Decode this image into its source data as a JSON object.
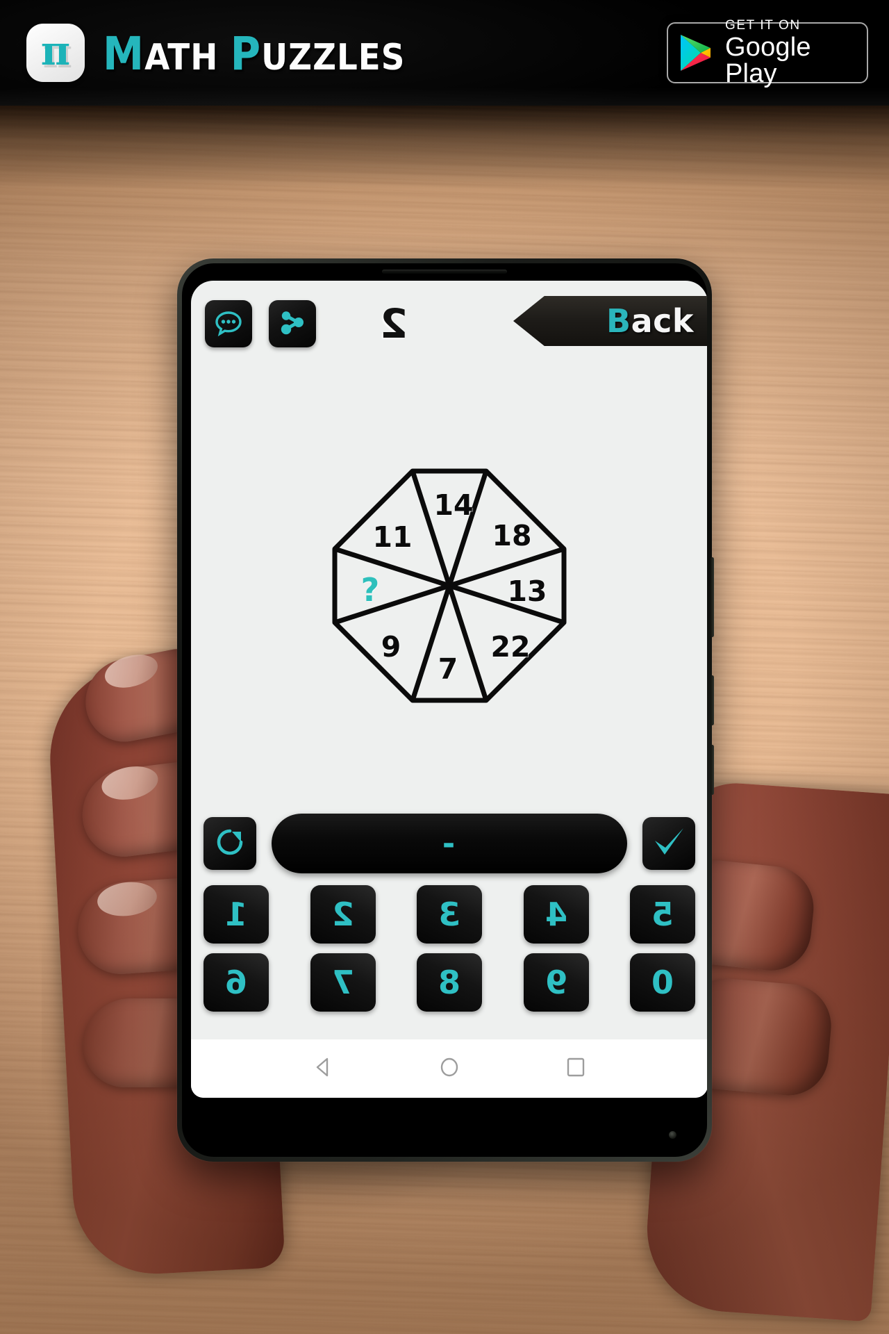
{
  "promo": {
    "app_icon_glyph": "π",
    "title_parts": [
      {
        "text": "M",
        "color": "teal",
        "size": "cap"
      },
      {
        "text": "ATH",
        "color": "white",
        "size": "sml"
      },
      {
        "text": " ",
        "color": "white",
        "size": "sml"
      },
      {
        "text": "P",
        "color": "teal",
        "size": "cap"
      },
      {
        "text": "UZZLES",
        "color": "white",
        "size": "sml"
      }
    ],
    "title_plain": "MATH PUZZLES",
    "store_badge": {
      "small_text": "GET IT ON",
      "big_text": "Google Play",
      "icon": "google-play-triangle-icon"
    }
  },
  "app": {
    "topbar": {
      "chat_icon": "chat-bubble-icon",
      "share_icon": "share-nodes-icon",
      "level_number": "2",
      "back_label_teal": "B",
      "back_label_white": "ack",
      "back_label_full": "Back"
    },
    "answer": {
      "reset_icon": "refresh-clockwise-icon",
      "submit_icon": "check-mark-icon",
      "value": "-",
      "placeholder": "-"
    },
    "keypad": {
      "row1": [
        "1",
        "2",
        "3",
        "4",
        "5"
      ],
      "row2": [
        "6",
        "7",
        "8",
        "9",
        "0"
      ]
    },
    "navbar": {
      "back_icon": "android-back-triangle-icon",
      "home_icon": "android-home-circle-icon",
      "recents_icon": "android-recents-square-icon"
    },
    "colors": {
      "accent_teal": "#2fc0c4",
      "key_black": "#0a0a0a",
      "screen_bg": "#eef0ef",
      "question_teal": "#2ec0bc"
    }
  },
  "chart_data": {
    "type": "pie",
    "title": "Octagon sector puzzle",
    "description": "Regular octagon divided into 8 triangular sectors meeting at the center; each sector carries a number, one is unknown.",
    "categories": [
      "top",
      "upper-right",
      "right",
      "lower-right",
      "bottom",
      "lower-left",
      "left",
      "upper-left"
    ],
    "values": [
      "14",
      "18",
      "13",
      "22",
      "7",
      "9",
      "?",
      "11"
    ],
    "labels": [
      {
        "sector": "top",
        "value": "14",
        "angle_deg": 270,
        "color": "#0b0b0b"
      },
      {
        "sector": "upper-right",
        "value": "18",
        "angle_deg": 315,
        "color": "#0b0b0b"
      },
      {
        "sector": "right",
        "value": "13",
        "angle_deg": 0,
        "color": "#0b0b0b"
      },
      {
        "sector": "lower-right",
        "value": "22",
        "angle_deg": 45,
        "color": "#0b0b0b"
      },
      {
        "sector": "bottom",
        "value": "7",
        "angle_deg": 90,
        "color": "#0b0b0b"
      },
      {
        "sector": "lower-left",
        "value": "9",
        "angle_deg": 135,
        "color": "#0b0b0b"
      },
      {
        "sector": "left",
        "value": "?",
        "angle_deg": 180,
        "color": "#2ec0bc"
      },
      {
        "sector": "upper-left",
        "value": "11",
        "angle_deg": 225,
        "color": "#0b0b0b"
      }
    ],
    "unknown_marker": "?",
    "shape": "octagon",
    "sector_count": 8,
    "stroke_color": "#000000",
    "fill_color": "#eef0ef",
    "legend": "none",
    "grid": false
  }
}
